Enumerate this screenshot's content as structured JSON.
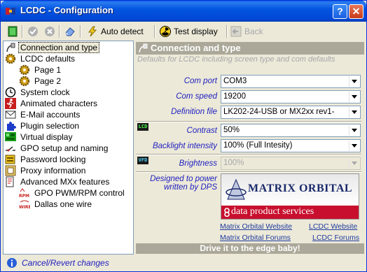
{
  "window": {
    "title": "LCDC - Configuration",
    "help_glyph": "?",
    "close_glyph": "✕"
  },
  "toolbar": {
    "auto_detect": "Auto detect",
    "test_display": "Test display",
    "back": "Back"
  },
  "tree": {
    "items": [
      {
        "label": "Connection and type",
        "icon": "plug-icon"
      },
      {
        "label": "LCDC defaults",
        "icon": "gear-icon"
      },
      {
        "label": "Page 1",
        "icon": "gear-icon"
      },
      {
        "label": "Page 2",
        "icon": "gear-icon"
      },
      {
        "label": "System clock",
        "icon": "clock-icon"
      },
      {
        "label": "Animated characters",
        "icon": "running-man-icon"
      },
      {
        "label": "E-Mail accounts",
        "icon": "envelope-icon"
      },
      {
        "label": "Plugin selection",
        "icon": "puzzle-icon"
      },
      {
        "label": "Virtual display",
        "icon": "virtual-display-icon"
      },
      {
        "label": "GPO setup and naming",
        "icon": "switch-icon"
      },
      {
        "label": "Password locking",
        "icon": "lock-icon"
      },
      {
        "label": "Proxy information",
        "icon": "proxy-icon"
      },
      {
        "label": "Advanced MXx features",
        "icon": "advanced-icon"
      },
      {
        "label": "GPO PWM/RPM control",
        "icon": "rpm-icon"
      },
      {
        "label": "Dallas one wire",
        "icon": "wire-icon"
      }
    ]
  },
  "panel": {
    "title": "Connection and type",
    "description": "Defaults for LCDC including screen type and com defaults",
    "com_port_label": "Com port",
    "com_port_value": "COM3",
    "com_speed_label": "Com speed",
    "com_speed_value": "19200",
    "definition_file_label": "Definition file",
    "definition_file_value": "LK202-24-USB or MX2xx rev1-",
    "lcd_badge": "LCD",
    "contrast_label": "Contrast",
    "contrast_value": "50%",
    "backlight_label": "Backlight intensity",
    "backlight_value": "100% (Full Intesity)",
    "vfd_badge": "VFD",
    "brightness_label": "Brightness",
    "brightness_value": "100%",
    "powered_by": "Designed to power written by DPS",
    "logo_top": "MATRIX ORBITAL",
    "logo_bottom": "data product services",
    "link_mo_website": "Matrix Orbital Website",
    "link_lcdc_website": "LCDC Website",
    "link_mo_forums": "Matrix Orbital Forums",
    "link_lcdc_forums": "LCDC Forums",
    "slogan": "Drive it to the edge baby!"
  },
  "status": {
    "text": "Cancel/Revert changes"
  },
  "colors": {
    "titlebar": "#0055e0",
    "label_blue": "#2020c0",
    "header_gray": "#aca899",
    "dps_red": "#c8102e"
  }
}
